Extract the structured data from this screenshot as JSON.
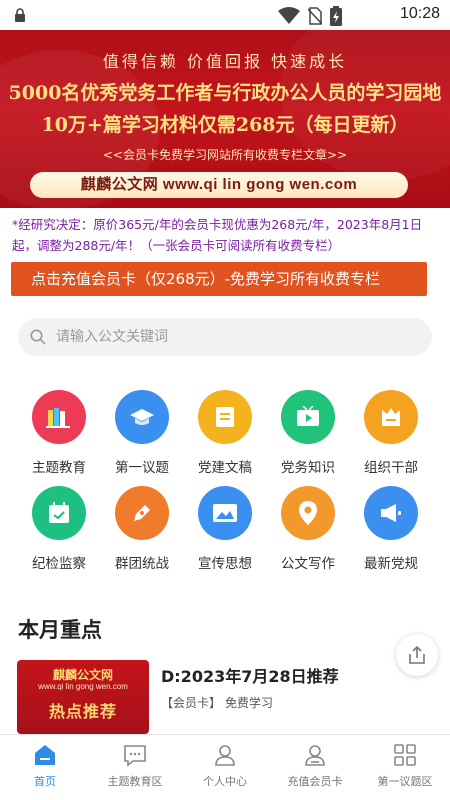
{
  "status_bar": {
    "time": "10:28"
  },
  "banner": {
    "tagline": "值得信赖  价值回报  快速成长",
    "headline": "5000名优秀党务工作者与行政办公人员的学习园地",
    "price_line": "10万+篇学习材料仅需268元（每日更新）",
    "member_note": "<<会员卡免费学习网站所有收费专栏文章>>",
    "site_text": "麒麟公文网  www.qi lin gong wen.com"
  },
  "notice": "*经研究决定：原价365元/年的会员卡现优惠为268元/年，2023年8月1日起，调整为288元/年！（一张会员卡可阅读所有收费专栏）",
  "recharge_button": "点击充值会员卡（仅268元）-免费学习所有收费专栏",
  "search": {
    "placeholder": "请输入公文关键词"
  },
  "categories": [
    {
      "label": "主题教育",
      "icon": "books-icon",
      "color": "#ee3b55"
    },
    {
      "label": "第一议题",
      "icon": "graduation-cap-icon",
      "color": "#3b8fee"
    },
    {
      "label": "党建文稿",
      "icon": "document-icon",
      "color": "#f5b21f"
    },
    {
      "label": "党务知识",
      "icon": "video-icon",
      "color": "#21c27a"
    },
    {
      "label": "组织干部",
      "icon": "crown-icon",
      "color": "#f5a220"
    },
    {
      "label": "纪检监察",
      "icon": "calendar-icon",
      "color": "#1dc080"
    },
    {
      "label": "群团统战",
      "icon": "pen-icon",
      "color": "#f07b2a"
    },
    {
      "label": "宣传思想",
      "icon": "image-icon",
      "color": "#3a8fef"
    },
    {
      "label": "公文写作",
      "icon": "location-pin-icon",
      "color": "#f3982a"
    },
    {
      "label": "最新党规",
      "icon": "megaphone-icon",
      "color": "#3a8fef"
    }
  ],
  "section": {
    "title": "本月重点"
  },
  "article": {
    "title": "D:2023年7月28日推荐",
    "tag": "【会员卡】",
    "tag2": "免费学习",
    "thumb_brand": "麒麟公文网",
    "thumb_url": "www.qi lin gong wen.com",
    "thumb_caption": "热点推荐"
  },
  "bottom_nav": [
    {
      "label": "首页",
      "icon": "home-icon",
      "active": true
    },
    {
      "label": "主题教育区",
      "icon": "chat-icon",
      "active": false
    },
    {
      "label": "个人中心",
      "icon": "user-icon",
      "active": false
    },
    {
      "label": "充值会员卡",
      "icon": "member-icon",
      "active": false
    },
    {
      "label": "第一议题区",
      "icon": "grid-icon",
      "active": false
    }
  ],
  "colors": {
    "accent_blue": "#2e8be8",
    "banner_red": "#b0101a",
    "cta_orange": "#e0531f",
    "notice_purple": "#7b1fa2"
  }
}
